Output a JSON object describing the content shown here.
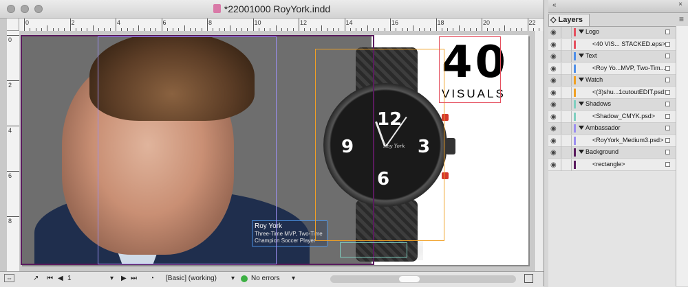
{
  "window": {
    "title": "*22001000 RoyYork.indd"
  },
  "ruler": {
    "h_labels": [
      "0",
      "2",
      "4",
      "6",
      "8",
      "10",
      "12",
      "14",
      "16",
      "18",
      "20",
      "22"
    ],
    "v_labels": [
      "0",
      "2",
      "4",
      "6",
      "8"
    ]
  },
  "artwork": {
    "big_number": "40",
    "brand_word": "VISUALS",
    "dial_numerals": [
      "12",
      "9",
      "3",
      "6"
    ],
    "dial_logo": "Roy York",
    "caption_title": "Roy York",
    "caption_line1": "Three-Time MVP, Two-Time",
    "caption_line2": "Champion Soccer Player"
  },
  "statusbar": {
    "page_number": "1",
    "preflight_profile": "[Basic] (working)",
    "errors": "No errors",
    "error_color": "#3cb043"
  },
  "layers_panel": {
    "tab_label": "Layers",
    "rows": [
      {
        "name": "Logo",
        "type": "parent",
        "color": "#e5505f"
      },
      {
        "name": "<40 VIS... STACKED.eps>",
        "type": "child",
        "color": "#e5505f"
      },
      {
        "name": "Text",
        "type": "parent",
        "color": "#4f8fe8"
      },
      {
        "name": "<Roy Yo...MVP, Two-Tim...>",
        "type": "child",
        "color": "#4f8fe8"
      },
      {
        "name": "Watch",
        "type": "parent",
        "color": "#f0a024"
      },
      {
        "name": "<(3)shu...1cutoutEDIT.psd>",
        "type": "child",
        "color": "#f0a024"
      },
      {
        "name": "Shadows",
        "type": "parent",
        "color": "#7fcfc0"
      },
      {
        "name": "<Shadow_CMYK.psd>",
        "type": "child",
        "color": "#7fcfc0"
      },
      {
        "name": "Ambassador",
        "type": "parent",
        "color": "#9b8ef0"
      },
      {
        "name": "<RoyYork_Medium3.psd>",
        "type": "child",
        "color": "#9b8ef0"
      },
      {
        "name": "Background",
        "type": "parent",
        "color": "#5a1b5e"
      },
      {
        "name": "<rectangle>",
        "type": "child",
        "color": "#5a1b5e"
      }
    ]
  },
  "colors": {
    "frame_logo": "#e5505f",
    "frame_text": "#4f8fe8",
    "frame_watch": "#f0a024",
    "frame_shadow": "#7fcfc0",
    "frame_ambassador": "#9b8ef0",
    "frame_background": "#5a1b5e"
  }
}
